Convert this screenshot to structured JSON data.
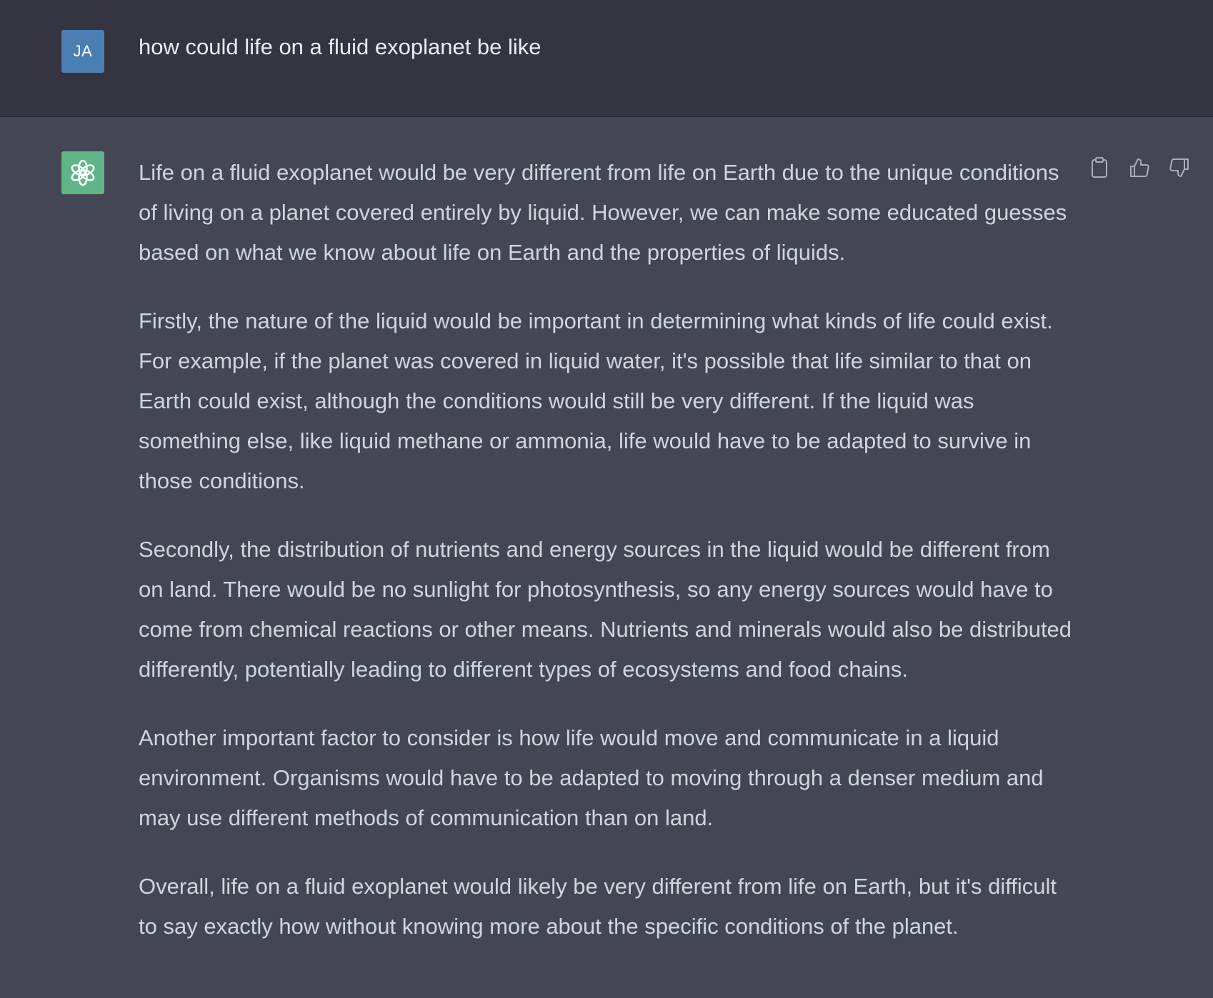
{
  "user_message": {
    "avatar_initials": "JA",
    "text": "how could life on a fluid exoplanet be like"
  },
  "assistant_message": {
    "avatar_icon": "openai-logo-icon",
    "paragraphs": [
      "Life on a fluid exoplanet would be very different from life on Earth due to the unique conditions of living on a planet covered entirely by liquid. However, we can make some educated guesses based on what we know about life on Earth and the properties of liquids.",
      "Firstly, the nature of the liquid would be important in determining what kinds of life could exist. For example, if the planet was covered in liquid water, it's possible that life similar to that on Earth could exist, although the conditions would still be very different. If the liquid was something else, like liquid methane or ammonia, life would have to be adapted to survive in those conditions.",
      "Secondly, the distribution of nutrients and energy sources in the liquid would be different from on land. There would be no sunlight for photosynthesis, so any energy sources would have to come from chemical reactions or other means. Nutrients and minerals would also be distributed differently, potentially leading to different types of ecosystems and food chains.",
      "Another important factor to consider is how life would move and communicate in a liquid environment. Organisms would have to be adapted to moving through a denser medium and may use different methods of communication than on land.",
      "Overall, life on a fluid exoplanet would likely be very different from life on Earth, but it's difficult to say exactly how without knowing more about the specific conditions of the planet."
    ],
    "actions": [
      "copy-icon",
      "thumbs-up-icon",
      "thumbs-down-icon"
    ]
  },
  "colors": {
    "user_background": "#343541",
    "assistant_background": "#444654",
    "user_avatar": "#4b7fb4",
    "assistant_avatar": "#5fb588",
    "text": "#d1d5db"
  }
}
